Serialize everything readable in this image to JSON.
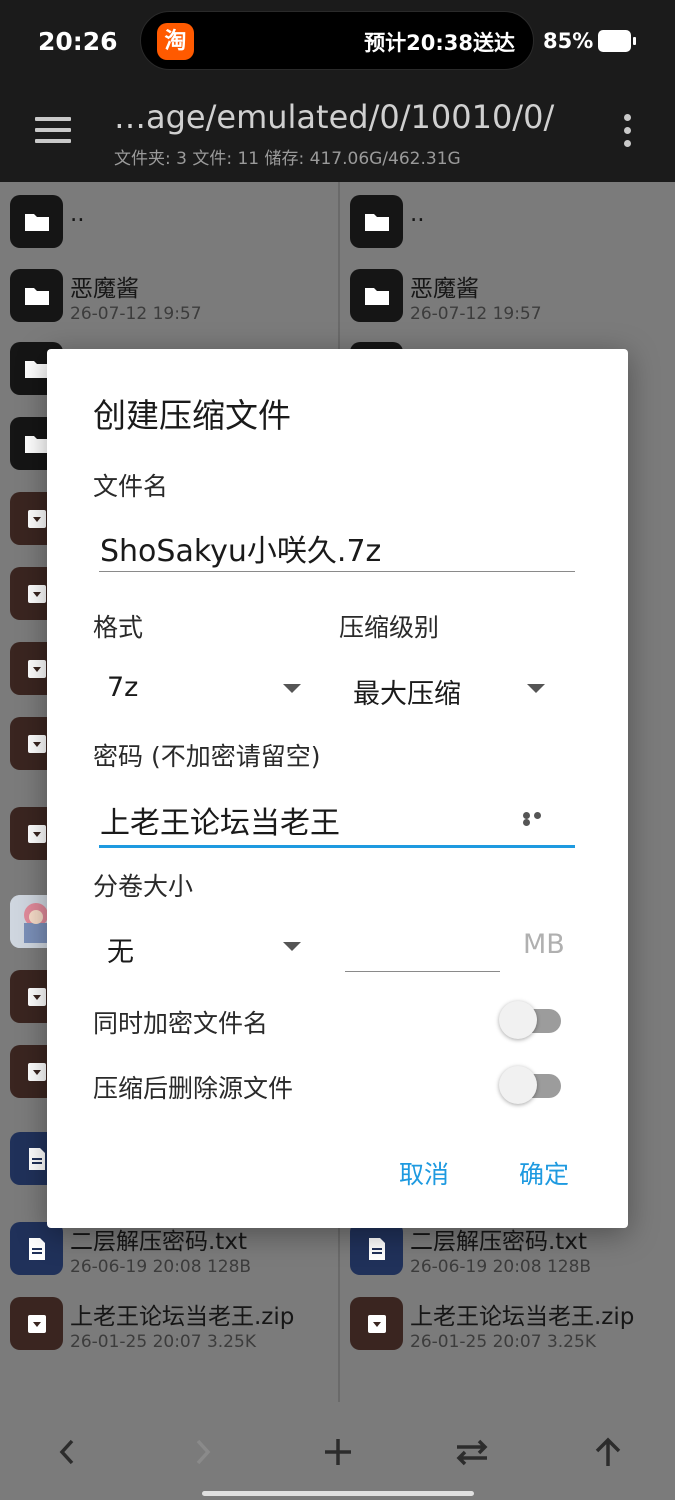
{
  "status_bar": {
    "time": "20:26",
    "island_app_icon": "淘",
    "island_text": "预计20:38送达",
    "battery_percent": "85%"
  },
  "toolbar": {
    "path": "…age/emulated/0/10010/0/",
    "subtitle": "文件夹: 3  文件: 11  储存: 417.06G/462.31G"
  },
  "left_panel": {
    "parent_dir": "..",
    "items": [
      {
        "name": "恶魔酱",
        "meta": "26-07-12 19:57"
      },
      {
        "name": "二层解压密码.txt",
        "meta": "26-06-19 20:08  128B"
      },
      {
        "name": "上老王论坛当老王.zip",
        "meta": "26-01-25 20:07  3.25K"
      }
    ]
  },
  "right_panel": {
    "parent_dir": "..",
    "items": [
      {
        "name": "恶魔酱",
        "meta": "26-07-12 19:57"
      },
      {
        "name": "二层解压密码.txt",
        "meta": "26-06-19 20:08  128B"
      },
      {
        "name": "上老王论坛当老王.zip",
        "meta": "26-01-25 20:07  3.25K"
      }
    ]
  },
  "dialog": {
    "title": "创建压缩文件",
    "filename_label": "文件名",
    "filename_value": "ShoSakyu小咲久.7z",
    "format_label": "格式",
    "format_value": "7z",
    "level_label": "压缩级别",
    "level_value": "最大压缩",
    "password_label": "密码 (不加密请留空)",
    "password_value": "上老王论坛当老王",
    "split_label": "分卷大小",
    "split_value": "无",
    "split_unit": "MB",
    "encrypt_names_label": "同时加密文件名",
    "encrypt_names_on": false,
    "delete_source_label": "压缩后删除源文件",
    "delete_source_on": false,
    "cancel_label": "取消",
    "ok_label": "确定"
  },
  "icons": {
    "menu": "hamburger-icon",
    "more": "more-vert-icon",
    "back": "chevron-left-icon",
    "forward": "chevron-right-icon",
    "add": "plus-icon",
    "swap": "swap-icon",
    "up": "arrow-up-icon"
  },
  "colors": {
    "accent": "#1e9ae0",
    "toolbar_bg": "#1b1b1b",
    "taobao_orange": "#ff5a00"
  }
}
